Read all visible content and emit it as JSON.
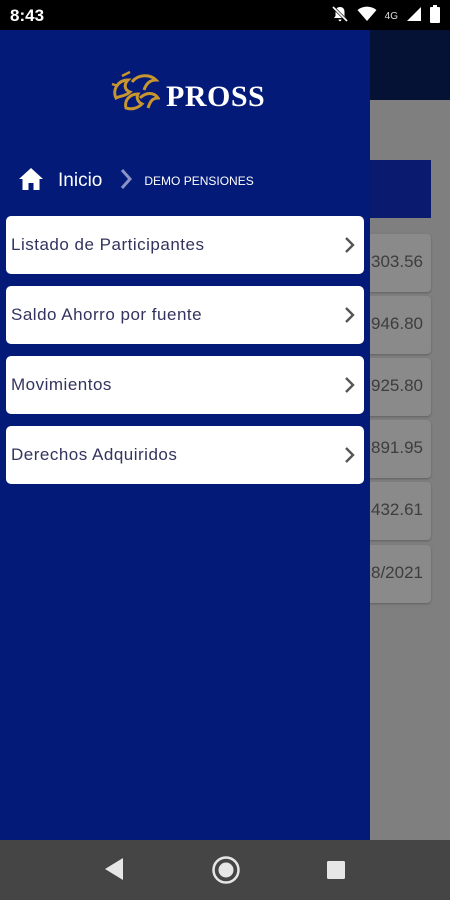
{
  "status_bar": {
    "time": "8:43",
    "network": "4G"
  },
  "background": {
    "rows": [
      "303.56",
      "946.80",
      "925.80",
      "891.95",
      "432.61",
      "8/2021"
    ]
  },
  "drawer": {
    "logo_text": "PROSS",
    "breadcrumb": {
      "home": "Inicio",
      "current": "DEMO PENSIONES"
    },
    "menu": [
      {
        "label": "Listado de Participantes"
      },
      {
        "label": "Saldo Ahorro por fuente"
      },
      {
        "label": "Movimientos"
      },
      {
        "label": "Derechos Adquiridos"
      }
    ]
  },
  "colors": {
    "drawer": "#031a78",
    "header": "#061235",
    "gold": "#c8962e"
  }
}
